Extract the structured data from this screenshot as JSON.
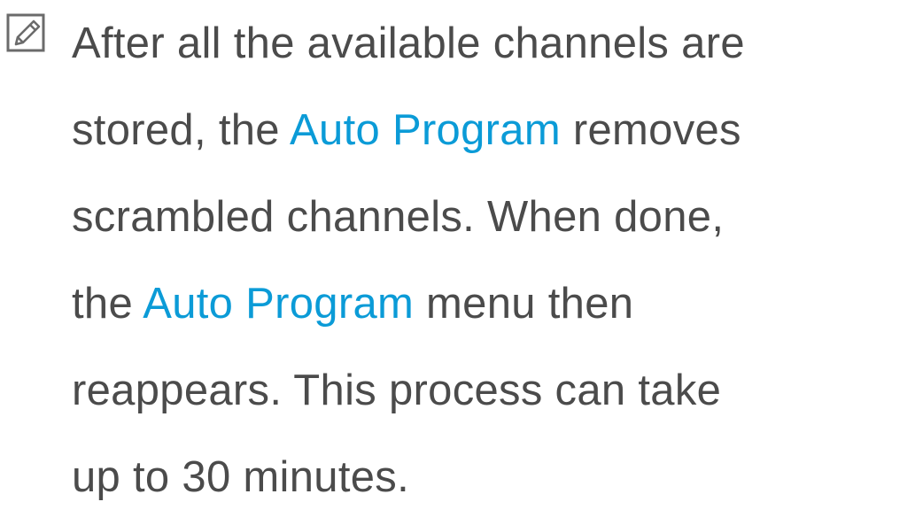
{
  "note": {
    "icon": "note-pencil-icon",
    "lines": [
      {
        "text": "After all the available channels are"
      },
      {
        "before": "stored, the ",
        "highlight": "Auto Program",
        "after": " removes"
      },
      {
        "text": "scrambled channels. When done,"
      },
      {
        "before": "the ",
        "highlight": "Auto Program",
        "after": " menu then"
      },
      {
        "text": "reappears. This process can take"
      },
      {
        "text": "up to 30 minutes."
      }
    ]
  },
  "colors": {
    "text": "#4b4b4b",
    "highlight": "#0b9bd7",
    "icon": "#6b6b6b",
    "background": "#ffffff"
  }
}
